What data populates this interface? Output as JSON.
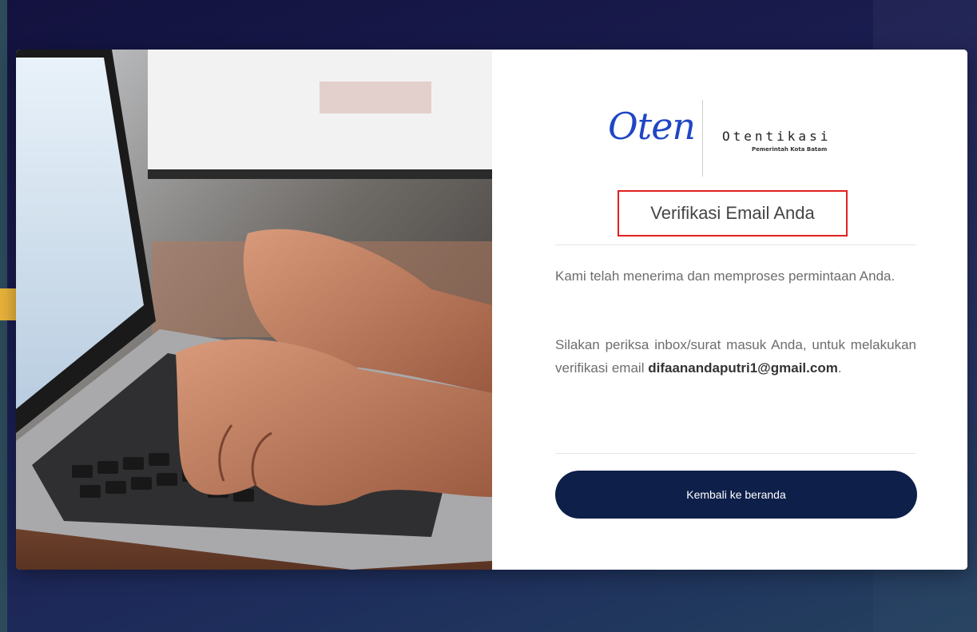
{
  "brand": {
    "script_logo": "Oten",
    "name": "Otentikasi",
    "subtitle": "Pemerintah Kota Batam",
    "script_color": "#1f46c4"
  },
  "verification": {
    "title": "Verifikasi Email Anda",
    "highlight_color": "#e0211f",
    "message_1": "Kami telah menerima dan memproses permintaan Anda.",
    "message_2_prefix": "Silakan periksa inbox/surat masuk Anda, untuk melakukan verifikasi email",
    "email": "difaanandaputri1@gmail.com",
    "message_2_suffix": "."
  },
  "actions": {
    "back_home_label": "Kembali ke beranda",
    "button_color": "#0e1f4a"
  },
  "decor": {
    "arrow_icon": "arrow-right-icon",
    "arrow_color": "#e8b33a",
    "photo_subject": "hands typing on laptop keyboard"
  }
}
